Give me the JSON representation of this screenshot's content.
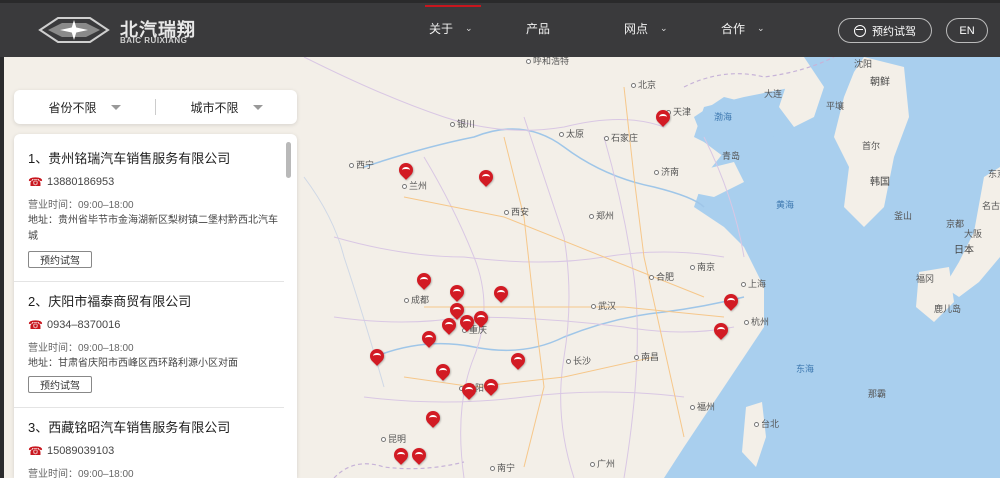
{
  "brand": {
    "name_cn": "北汽瑞翔",
    "name_en": "BAIC RUIXIANG"
  },
  "nav": [
    {
      "label": "关于",
      "has_dropdown": true
    },
    {
      "label": "产品",
      "has_dropdown": false
    },
    {
      "label": "网点",
      "has_dropdown": true
    },
    {
      "label": "合作",
      "has_dropdown": true
    }
  ],
  "header_buttons": {
    "test_drive": "预约试驾",
    "language": "EN"
  },
  "filter": {
    "province": "省份不限",
    "city": "城市不限"
  },
  "dealers": [
    {
      "name": "1、贵州铭瑞汽车销售服务有限公司",
      "phone": "13880186953",
      "hours": "营业时间：09:00–18:00",
      "address_label": "地址：",
      "address": "贵州省毕节市金海湖新区梨树镇二堡村黔西北汽车城",
      "button": "预约试驾"
    },
    {
      "name": "2、庆阳市福泰商贸有限公司",
      "phone": "0934–8370016",
      "hours": "营业时间：09:00–18:00",
      "address_label": "地址：",
      "address": "甘肃省庆阳市西峰区西环路利源小区对面",
      "button": "预约试驾"
    },
    {
      "name": "3、西藏铭昭汽车销售服务有限公司",
      "phone": "15089039103",
      "hours": "营业时间：09:00–18:00"
    }
  ],
  "map": {
    "land_color": "#f3efe8",
    "sea_color": "#a9cfee",
    "pin_color": "#d21b24",
    "cities": [
      "呼和浩特",
      "北京",
      "天津",
      "银川",
      "太原",
      "石家庄",
      "西宁",
      "兰州",
      "济南",
      "西安",
      "郑州",
      "合肥",
      "南京",
      "上海",
      "成都",
      "武汉",
      "杭州",
      "重庆",
      "长沙",
      "南昌",
      "贵阳",
      "福州",
      "昆明",
      "南宁",
      "广州",
      "台北"
    ],
    "countries": [
      "朝鲜",
      "韩国",
      "日本"
    ],
    "seas": [
      "渤海",
      "黄海",
      "东海"
    ],
    "other_labels": [
      "沈阳",
      "平壤",
      "首尔",
      "大连",
      "青岛",
      "釜山",
      "福冈",
      "鹿儿岛",
      "大阪",
      "名古屋",
      "东京",
      "京都",
      "那霸"
    ]
  }
}
